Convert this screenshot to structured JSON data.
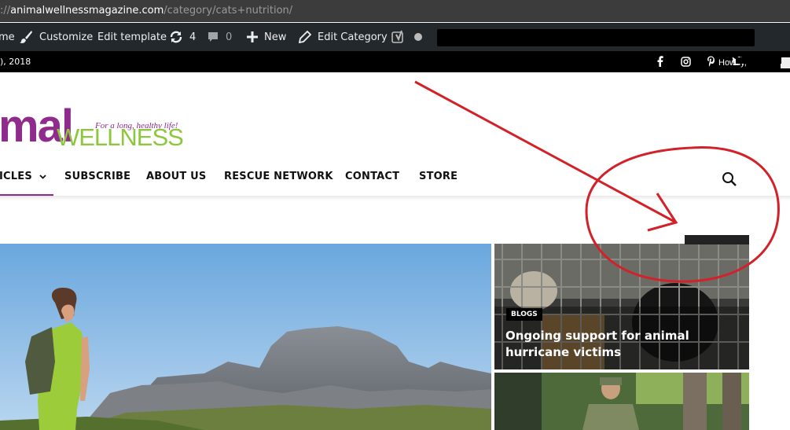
{
  "browser": {
    "url_scheme": "://",
    "url_host": "animalwellnessmagazine.com",
    "url_path": "/category/cats+nutrition/"
  },
  "admin_bar": {
    "home_label": "me",
    "customize_label": "Customize",
    "edit_template_label": "Edit template",
    "updates_count": "4",
    "comments_count": "0",
    "new_label": "New",
    "edit_category_label": "Edit Category"
  },
  "top_bar": {
    "date": "), 2018",
    "welcome": "Howdy,"
  },
  "logo": {
    "name_part": "mal",
    "wellness": "WELLNESS",
    "tagline": "For a long, healthy life!"
  },
  "nav": {
    "items": [
      "ICLES",
      "SUBSCRIBE",
      "ABOUT US",
      "RESCUE NETWORK",
      "CONTACT",
      "STORE"
    ]
  },
  "featured": {
    "side_category": "BLOGS",
    "side_title": "Ongoing support for animal hurricane victims"
  },
  "colors": {
    "brand_purple": "#8e2b8c",
    "brand_green": "#8dc63f",
    "admin_bar": "#23282d",
    "annotation_red": "#d22128"
  },
  "icons": {
    "customize": "paintbrush-icon",
    "updates": "refresh-icon",
    "comments": "comment-icon",
    "new": "plus-icon",
    "edit": "pencil-icon",
    "yoast": "yoast-icon",
    "status": "status-dot-icon",
    "facebook": "facebook-icon",
    "instagram": "instagram-icon",
    "pinterest": "pinterest-icon",
    "twitter": "twitter-icon",
    "search": "search-icon"
  }
}
